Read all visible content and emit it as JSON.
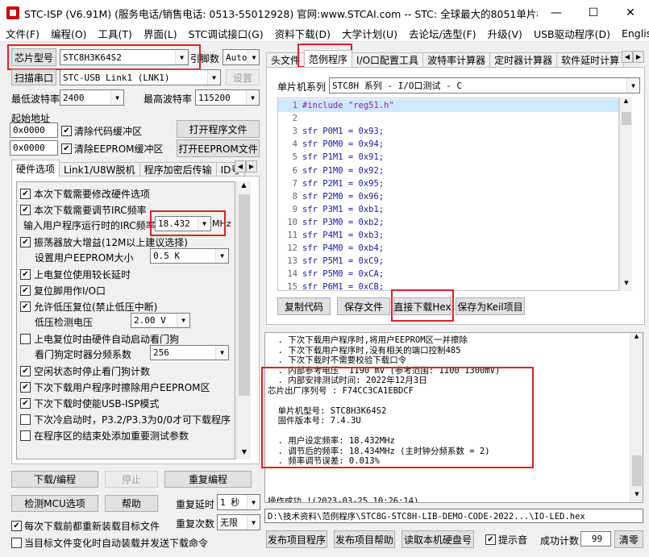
{
  "window": {
    "title": "STC-ISP (V6.91M) (服务电话/销售电话: 0513-55012928) 官网:www.STCAI.com  -- STC: 全球最大的8051单片机设...",
    "min": "—",
    "max": "☐",
    "close": "✕"
  },
  "menu": [
    "文件(F)",
    "编程(O)",
    "工具(T)",
    "界面(L)",
    "STC调试接口(G)",
    "资料下载(D)",
    "大学计划(U)",
    "去论坛/选型(F)",
    "升级(V)",
    "USB驱动程序(D)",
    "English"
  ],
  "left": {
    "chip_type_button": "芯片型号",
    "chip_type_value": "STC8H3K64S2",
    "pin_label": "引脚数",
    "pin_value": "Auto",
    "scan_button": "扫描串口",
    "port_value": "STC-USB Link1 (LNK1)",
    "settings_button": "设置",
    "min_baud_label": "最低波特率",
    "min_baud_value": "2400",
    "max_baud_label": "最高波特率",
    "max_baud_value": "115200",
    "start_addr_label": "起始地址",
    "addr1_value": "0x0000",
    "clear_code_label": "清除代码缓冲区",
    "open_prog_button": "打开程序文件",
    "addr2_value": "0x0000",
    "clear_eeprom_label": "清除EEPROM缓冲区",
    "open_eeprom_button": "打开EEPROM文件",
    "tabs": [
      "硬件选项",
      "Link1/U8W脱机",
      "程序加密后传输",
      "ID号"
    ],
    "tab_arrows": [
      "◀",
      "▶"
    ],
    "options": [
      {
        "label": "本次下载需要修改硬件选项",
        "checked": true
      },
      {
        "label": "本次下载需要调节IRC频率",
        "checked": true
      },
      {
        "label": "振荡器放大增益(12M以上建议选择)",
        "checked": true
      },
      {
        "label": "上电复位使用较长延时",
        "checked": true
      },
      {
        "label": "复位脚用作I/O口",
        "checked": true
      },
      {
        "label": "允许低压复位(禁止低压中断)",
        "checked": true
      },
      {
        "label": "上电复位时由硬件自动启动看门狗",
        "checked": false
      },
      {
        "label": "空闲状态时停止看门狗计数",
        "checked": true
      },
      {
        "label": "下次下载用户程序时擦除用户EEPROM区",
        "checked": true
      },
      {
        "label": "下次下载时使能USB-ISP模式",
        "checked": true
      },
      {
        "label": "下次冷启动时，P3.2/P3.3为0/0才可下载程序",
        "checked": false
      },
      {
        "label": "在程序区的结束处添加重要测试参数",
        "checked": false
      }
    ],
    "irc_label": "输入用户程序运行时的IRC频率",
    "irc_value": "18.432",
    "irc_unit": "MHz",
    "eeprom_size_label": "设置用户EEPROM大小",
    "eeprom_size_value": "0.5 K",
    "lvd_label": "低压检测电压",
    "lvd_value": "2.00 V",
    "wdt_label": "看门狗定时器分频系数",
    "wdt_value": "256",
    "download_button": "下载/编程",
    "stop_button": "停止",
    "reprogram_button": "重复编程",
    "detect_button": "检测MCU选项",
    "help_button": "帮助",
    "repeat_delay_label": "重复延时",
    "repeat_delay_value": "1 秒",
    "repeat_count_label": "重复次数",
    "repeat_count_value": "无限",
    "reload_label": "每次下载前都重新装载目标文件",
    "reload_checked": true,
    "auto_label": "当目标文件变化时自动装载并发送下载命令",
    "auto_checked": false
  },
  "right": {
    "tabs": [
      "头文件",
      "范例程序",
      "I/O口配置工具",
      "波特率计算器",
      "定时器计算器",
      "软件延时计算"
    ],
    "tab_arrows": [
      "◀",
      "▶"
    ],
    "series_label": "单片机系列",
    "series_value": "STC8H 系列 - I/O口测试 - C",
    "code_lines": [
      {
        "n": "1",
        "t": "#include \"reg51.h\"",
        "pre": true
      },
      {
        "n": "2",
        "t": ""
      },
      {
        "n": "3",
        "t": "sfr P0M1 = 0x93;"
      },
      {
        "n": "4",
        "t": "sfr P0M0 = 0x94;"
      },
      {
        "n": "5",
        "t": "sfr P1M1 = 0x91;"
      },
      {
        "n": "6",
        "t": "sfr P1M0 = 0x92;"
      },
      {
        "n": "7",
        "t": "sfr P2M1 = 0x95;"
      },
      {
        "n": "8",
        "t": "sfr P2M0 = 0x96;"
      },
      {
        "n": "9",
        "t": "sfr P3M1 = 0xb1;"
      },
      {
        "n": "10",
        "t": "sfr P3M0 = 0xb2;"
      },
      {
        "n": "11",
        "t": "sfr P4M1 = 0xb3;"
      },
      {
        "n": "12",
        "t": "sfr P4M0 = 0xb4;"
      },
      {
        "n": "13",
        "t": "sfr P5M1 = 0xC9;"
      },
      {
        "n": "14",
        "t": "sfr P5M0 = 0xCA;"
      },
      {
        "n": "15",
        "t": "sfr P6M1 = 0xCB;"
      }
    ],
    "copy_button": "复制代码",
    "save_button": "保存文件",
    "direct_hex_button": "直接下载Hex",
    "save_keil_button": "保存为Keil项目",
    "log_lines": [
      "  . 下次下载用户程序时,将用户EEPROM区一并擦除",
      "  . 下次下载用户程序时,没有相关的端口控制485",
      "  . 下次下载时不需要校验下载口令",
      "  . 内部参考电压  1190 mV (参考范围: 1100 1300mV)",
      "  . 内部安排测试时间: 2022年12月3日",
      "芯片出厂序列号 : F74CC3CA1EBDCF",
      "",
      "  单片机型号: STC8H3K64S2",
      "  固件版本号: 7.4.3U",
      "",
      "  . 用户设定频率: 18.432MHz",
      "  . 调节后的频率: 18.434MHz (主时钟分频系数 = 2)",
      "  . 频率调节误差: 0.013%",
      "",
      "",
      "",
      "操作成功 !(2023-03-25 10:26:14)"
    ],
    "path_value": "D:\\技术资料\\范例程序\\STC8G-STC8H-LIB-DEMO-CODE-2022...\\IO-LED.hex",
    "publish_button": "发布项目程序",
    "publish_help_button": "发布项目帮助",
    "read_serial_button": "读取本机硬盘号",
    "sound_label": "提示音",
    "sound_checked": true,
    "success_label": "成功计数",
    "success_value": "99",
    "clear_button": "清零"
  },
  "colors": {
    "highlight": "#e0202a",
    "code_keyword": "#1a1aa6",
    "line_highlight": "#cfe8fc"
  }
}
